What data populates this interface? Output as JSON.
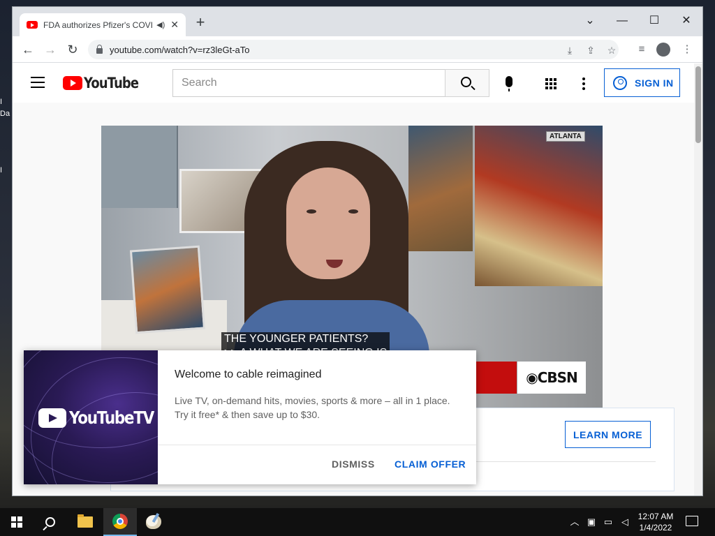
{
  "browser": {
    "tab_title": "FDA authorizes Pfizer's COVI",
    "speaker_icon": "speaker-icon",
    "tab_close": "✕",
    "new_tab": "+",
    "url": "youtube.com/watch?v=rz3leGt-aTo",
    "window_controls": {
      "dropdown": "⌄",
      "minimize": "—",
      "maximize": "☐",
      "close": "✕"
    }
  },
  "youtube": {
    "logo_text": "YouTube",
    "search_placeholder": "Search",
    "sign_in": "SIGN IN"
  },
  "video": {
    "location_badge": "ATLANTA",
    "caption_line1": "THE YOUNGER PATIENTS?",
    "caption_line2": ">> A WHAT WE ARE SEEING IS",
    "network_logo": "◉CBSN"
  },
  "ad_card": {
    "learn_more": "LEARN MORE"
  },
  "promo": {
    "brand": "YouTubeTV",
    "title": "Welcome to cable reimagined",
    "body_line1": "Live TV, on-demand hits, movies, sports & more – all in 1 place.",
    "body_line2": "Try it free* & then save up to $30.",
    "dismiss": "DISMISS",
    "claim": "CLAIM OFFER"
  },
  "taskbar": {
    "time": "12:07 AM",
    "date": "1/4/2022"
  },
  "colors": {
    "youtube_red": "#ff0000",
    "link_blue": "#065fd4",
    "promo_bg": "#2a1a55"
  }
}
